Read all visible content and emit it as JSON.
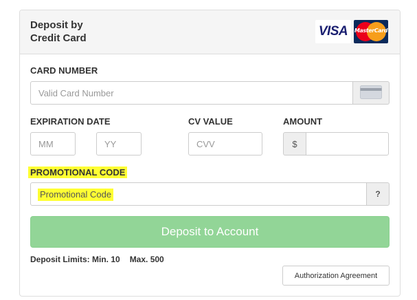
{
  "header": {
    "title_line1": "Deposit by",
    "title_line2": "Credit Card",
    "visa_logo_text": "VISA",
    "mastercard_logo_text": "MasterCard"
  },
  "card_number": {
    "label": "CARD NUMBER",
    "value": "",
    "placeholder": "Valid Card Number",
    "icon": "credit-card-icon"
  },
  "expiration": {
    "label": "EXPIRATION DATE",
    "month_placeholder": "MM",
    "year_placeholder": "YY",
    "month_value": "",
    "year_value": ""
  },
  "cvv": {
    "label": "CV VALUE",
    "placeholder": "CVV",
    "value": ""
  },
  "amount": {
    "label": "AMOUNT",
    "currency_symbol": "$",
    "value": ""
  },
  "promo": {
    "label": "PROMOTIONAL CODE",
    "value": "Promotional Code",
    "help_label": "?"
  },
  "actions": {
    "deposit_label": "Deposit to Account",
    "authorization_label": "Authorization Agreement"
  },
  "limits": {
    "min_text": "Deposit Limits: Min. 10",
    "max_text": "Max. 500"
  },
  "colors": {
    "highlight": "#ffff33",
    "deposit_button": "#92d597",
    "header_bg": "#f5f5f5"
  }
}
